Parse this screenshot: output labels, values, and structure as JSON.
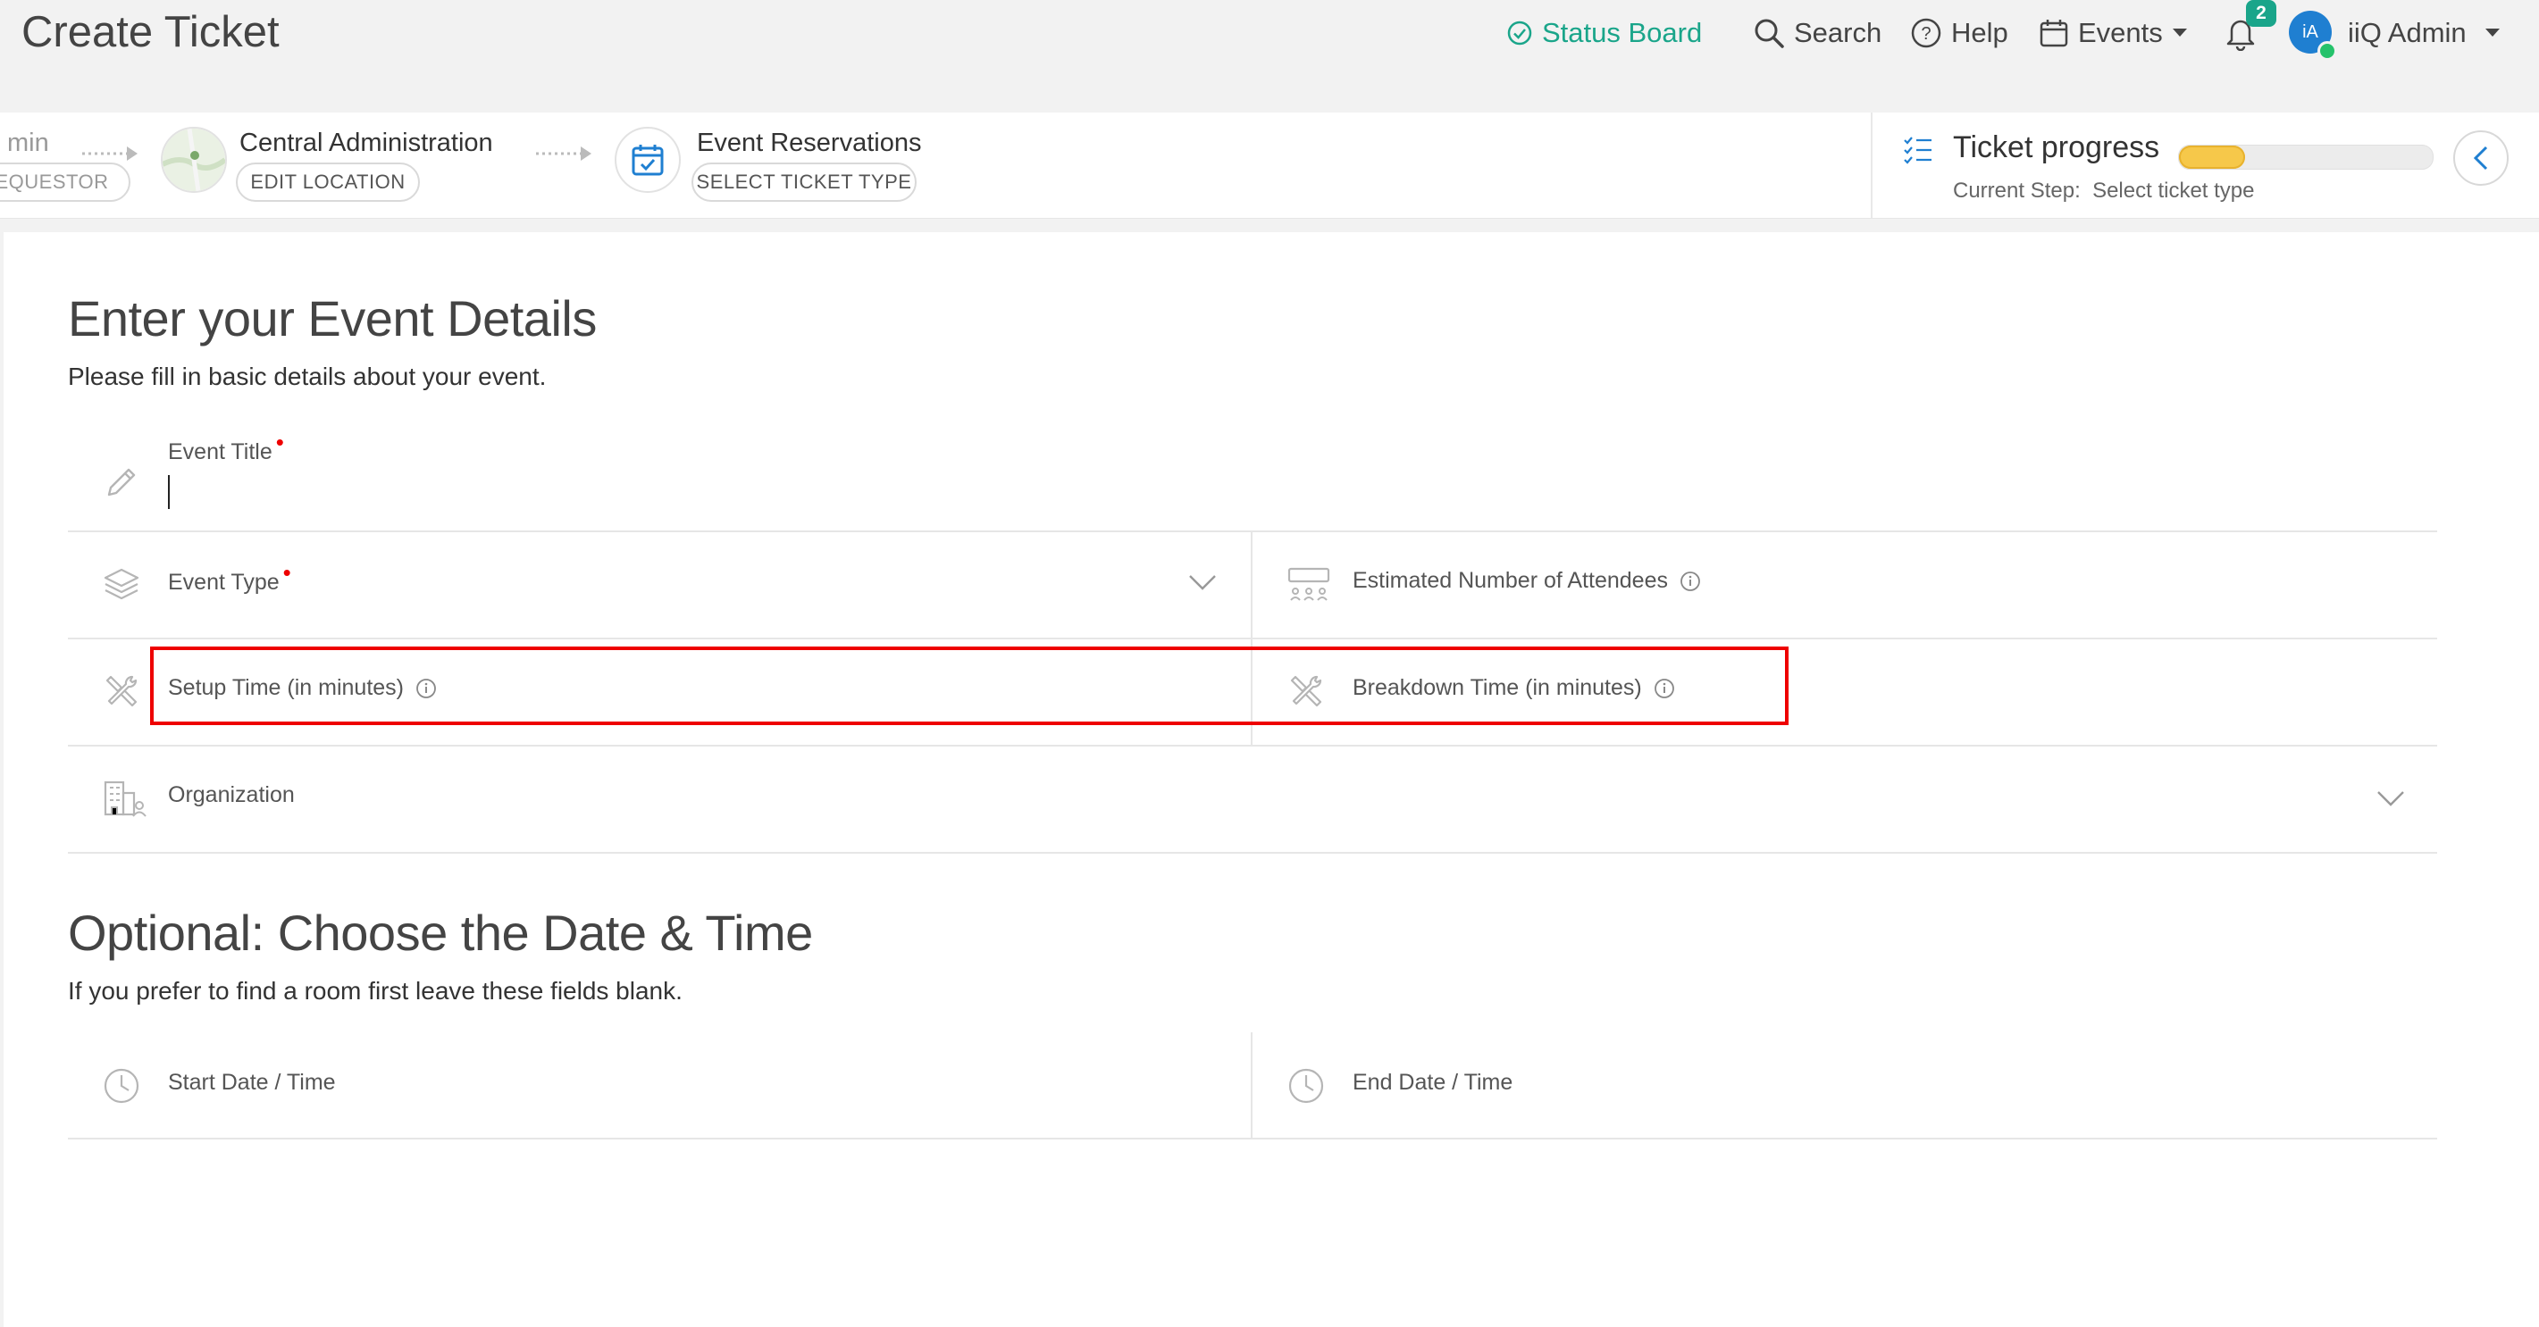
{
  "header": {
    "title": "Create Ticket",
    "nav": {
      "status_board": "Status Board",
      "search": "Search",
      "help": "Help",
      "events": "Events",
      "notifications_count": "2",
      "avatar_initials": "iA",
      "user_name": "iiQ Admin"
    }
  },
  "steps": [
    {
      "label": "min",
      "button": "EQUESTOR"
    },
    {
      "label": "Central Administration",
      "button": "EDIT LOCATION"
    },
    {
      "label": "Event Reservations",
      "button": "SELECT TICKET TYPE"
    }
  ],
  "progress": {
    "title": "Ticket progress",
    "current_step_label": "Current Step:",
    "current_step_value": "Select ticket type",
    "fill_fraction": 0.26,
    "fill_color": "#f6c84a"
  },
  "event_details": {
    "title": "Enter your Event Details",
    "subtitle": "Please fill in basic details about your event.",
    "fields": {
      "event_title": "Event Title",
      "event_type": "Event Type",
      "attendees": "Estimated Number of Attendees",
      "setup_time": "Setup Time (in minutes)",
      "breakdown_time": "Breakdown Time (in minutes)",
      "organization": "Organization"
    },
    "required_mark": "•"
  },
  "date_time": {
    "title": "Optional: Choose the Date & Time",
    "subtitle": "If you prefer to find a room first leave these fields blank.",
    "fields": {
      "start": "Start Date / Time",
      "end": "End Date / Time"
    }
  },
  "colors": {
    "accent": "#1aa58a",
    "highlight": "#e00000",
    "avatar": "#1f7fd1"
  }
}
